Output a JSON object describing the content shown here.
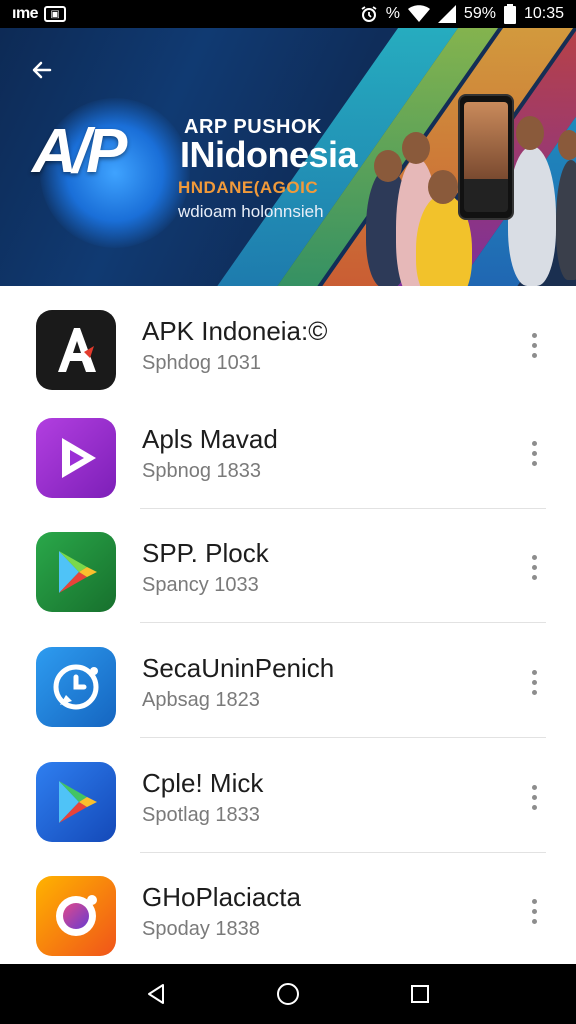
{
  "status_bar": {
    "carrier": "ıme",
    "battery_pct": "59%",
    "time": "10:35",
    "data_label": "%"
  },
  "banner": {
    "logo_mark": "A/P",
    "brand_top": "ARP PUSHOK",
    "brand_main": "INidonesia",
    "brand_sub": "HNDANE(AGOIC",
    "brand_tag": "wdioam holonnsieh"
  },
  "apps": [
    {
      "name": "APK Indoneia:©",
      "subtitle": "Sphdog 1031",
      "icon": "apk-a-icon",
      "color": "#1a1a1a"
    },
    {
      "name": "Apls Mavad",
      "subtitle": "Spbnog 1833",
      "icon": "play-triangle-icon",
      "color": "#9b2fd6"
    },
    {
      "name": "SPP. Plock",
      "subtitle": "Spancy 1033",
      "icon": "play-store-icon",
      "color": "#1f8f3a"
    },
    {
      "name": "SecaUninPenich",
      "subtitle": "Apbsag 1823",
      "icon": "chat-bubble-icon",
      "color": "#1e88e5"
    },
    {
      "name": "Cple! Mick",
      "subtitle": "Spotlag 1833",
      "icon": "play-store-icon",
      "color": "#1e6fe0"
    },
    {
      "name": "GHoPlaciacta",
      "subtitle": "Spoday 1838",
      "icon": "camera-lens-icon",
      "color": "#f07a1a"
    }
  ]
}
